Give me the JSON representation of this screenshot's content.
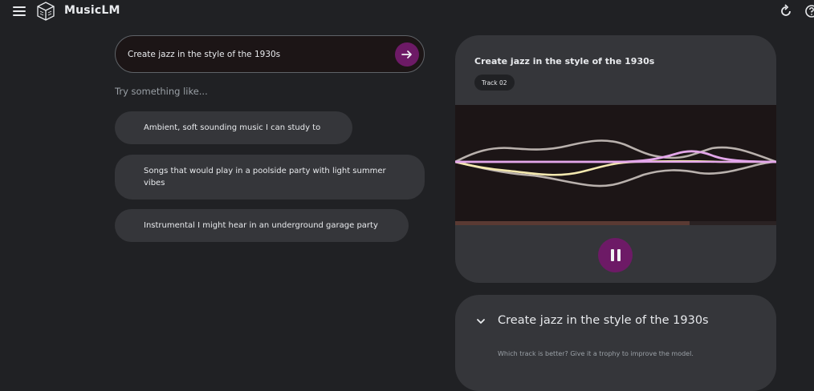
{
  "app": {
    "title": "MusicLM",
    "icons": {
      "menu": "menu-icon",
      "logo": "cube-logo-icon",
      "refresh": "refresh-icon",
      "help": "help-icon",
      "send": "arrow-right-icon",
      "pause": "pause-icon",
      "chevron": "chevron-down-icon"
    }
  },
  "prompt": {
    "value": "Create jazz in the style of the 1930s"
  },
  "suggestions": {
    "heading": "Try something like...",
    "items": [
      "Ambient, soft sounding music I can study to",
      "Songs that would play in a poolside party with light summer vibes",
      "Instrumental I might hear in an underground garage party"
    ]
  },
  "player": {
    "title": "Create jazz in the style of the 1930s",
    "track_label": "Track 02",
    "progress_fraction": 0.73,
    "state": "playing"
  },
  "compare": {
    "title": "Create jazz in the style of the 1930s",
    "hint": "Which track is better? Give it a trophy to improve the model."
  },
  "colors": {
    "background": "#202124",
    "card": "#35363a",
    "accent": "#6d1a66",
    "wave_pink": "#e3a6ea",
    "wave_cream": "#f4e9b0",
    "wave_gray": "#b9b1ad"
  }
}
